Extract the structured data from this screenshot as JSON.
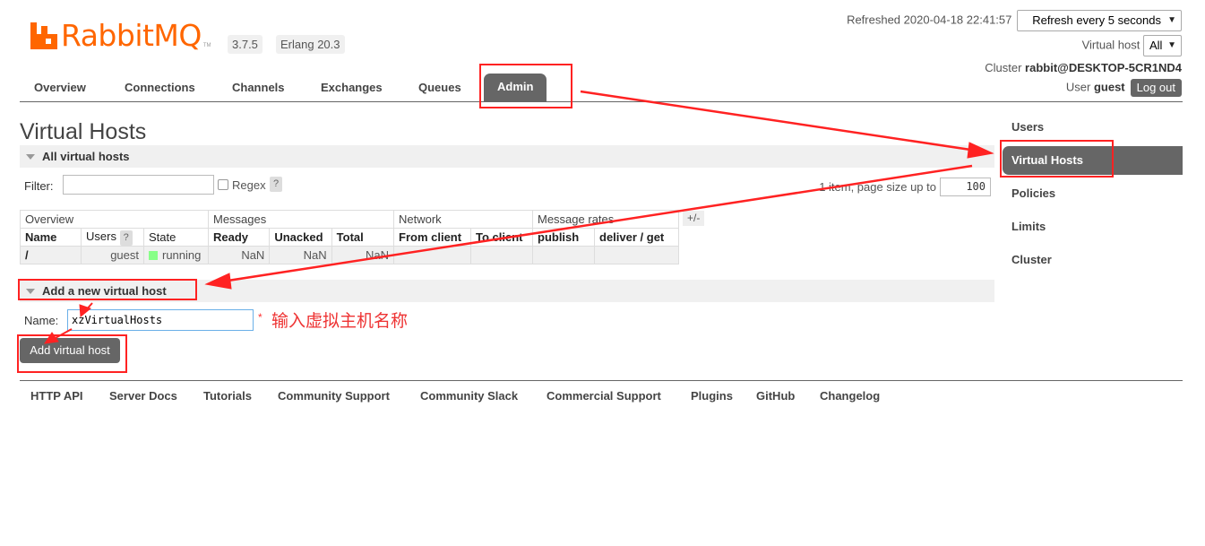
{
  "header": {
    "logo_text": "RabbitMQ",
    "logo_tm": "TM",
    "version": "3.7.5",
    "erlang": "Erlang 20.3",
    "refreshed_label": "Refreshed 2020-04-18 22:41:57",
    "refresh_select": "Refresh every 5 seconds",
    "vhost_label": "Virtual host",
    "vhost_select": "All",
    "cluster_label": "Cluster",
    "cluster_name": "rabbit@DESKTOP-5CR1ND4",
    "user_label": "User",
    "user_name": "guest",
    "logout_label": "Log out"
  },
  "tabs": [
    "Overview",
    "Connections",
    "Channels",
    "Exchanges",
    "Queues",
    "Admin"
  ],
  "active_tab": "Admin",
  "page_title": "Virtual Hosts",
  "all_vhosts": {
    "section_title": "All virtual hosts",
    "filter_label": "Filter:",
    "regex_label": "Regex",
    "help": "?",
    "paging_text": "1 item, page size up to",
    "page_size": "100",
    "plus_minus": "+/-",
    "group_headers": [
      "Overview",
      "Messages",
      "Network",
      "Message rates"
    ],
    "columns": [
      "Name",
      "Users",
      "State",
      "Ready",
      "Unacked",
      "Total",
      "From client",
      "To client",
      "publish",
      "deliver / get"
    ],
    "rows": [
      {
        "name": "/",
        "users": "guest",
        "state": "running",
        "ready": "NaN",
        "unacked": "NaN",
        "total": "NaN",
        "from_client": "",
        "to_client": "",
        "publish": "",
        "deliver_get": ""
      }
    ]
  },
  "add_vhost": {
    "section_title": "Add a new virtual host",
    "name_label": "Name:",
    "name_value": "xzVirtualHosts",
    "required_mark": "*",
    "annotation_note": "输入虚拟主机名称",
    "button_label": "Add virtual host"
  },
  "footer_links": [
    "HTTP API",
    "Server Docs",
    "Tutorials",
    "Community Support",
    "Community Slack",
    "Commercial Support",
    "Plugins",
    "GitHub",
    "Changelog"
  ],
  "sidebar": {
    "items": [
      "Users",
      "Virtual Hosts",
      "Policies",
      "Limits",
      "Cluster"
    ],
    "active": "Virtual Hosts"
  },
  "colors": {
    "brand_orange": "#ff6600",
    "tab_active": "#666666",
    "annotation_red": "#ff2222",
    "running_green": "#88ff88"
  }
}
